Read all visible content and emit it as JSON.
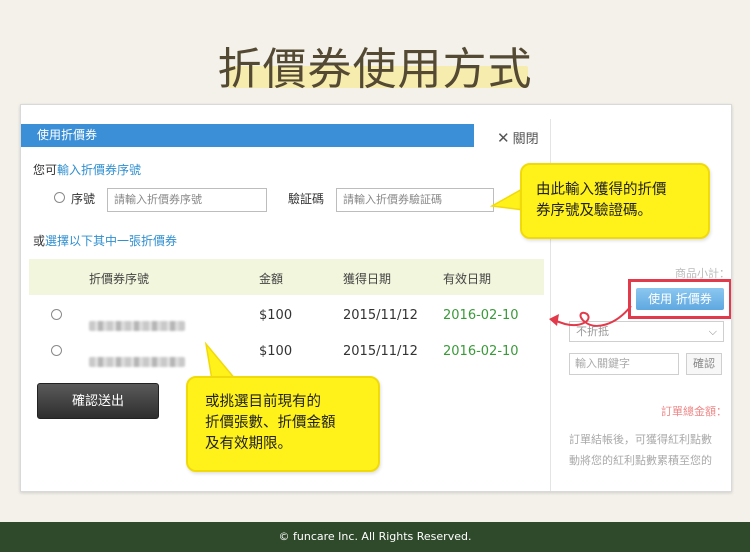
{
  "page": {
    "title": "折價券使用方式",
    "footer": "© funcare Inc. All Rights Reserved."
  },
  "modal": {
    "header": "使用折價券",
    "close_label": "關閉",
    "enter_prefix": "您可",
    "enter_link": "輸入折價券序號",
    "serial_label": "序號",
    "serial_placeholder": "請輸入折價券序號",
    "verify_label": "驗証碼",
    "verify_placeholder": "請輸入折價券驗証碼",
    "select_prefix": "或",
    "select_link": "選擇以下其中一張折價券",
    "columns": [
      "折價券序號",
      "金額",
      "獲得日期",
      "有效日期"
    ],
    "rows": [
      {
        "amount": "$100",
        "obtained": "2015/11/12",
        "expires": "2016-02-10"
      },
      {
        "amount": "$100",
        "obtained": "2015/11/12",
        "expires": "2016-02-10"
      }
    ],
    "submit_label": "確認送出"
  },
  "right_panel": {
    "subtotal_label": "商品小計：",
    "use_coupon_label": "使用 折價券",
    "discount_select": "不折抵",
    "keyword_placeholder": "輸入關鍵字",
    "confirm_label": "確認",
    "total_label": "訂單總金額：",
    "note_line1": "訂單結帳後，可獲得紅利點數",
    "note_line2": "動將您的紅利點數累積至您的"
  },
  "callouts": {
    "top_line1": "由此輸入獲得的折價",
    "top_line2": "券序號及驗證碼。",
    "bottom_line1": "或挑選目前現有的",
    "bottom_line2": "折價張數、折價金額",
    "bottom_line3": "及有效期限。"
  },
  "colors": {
    "header_blue": "#3b8fd6",
    "highlight_red": "#e23a4b",
    "callout_yellow": "#fff21a",
    "footer_green": "#2f4a2b",
    "date_green": "#3a9a3a"
  }
}
